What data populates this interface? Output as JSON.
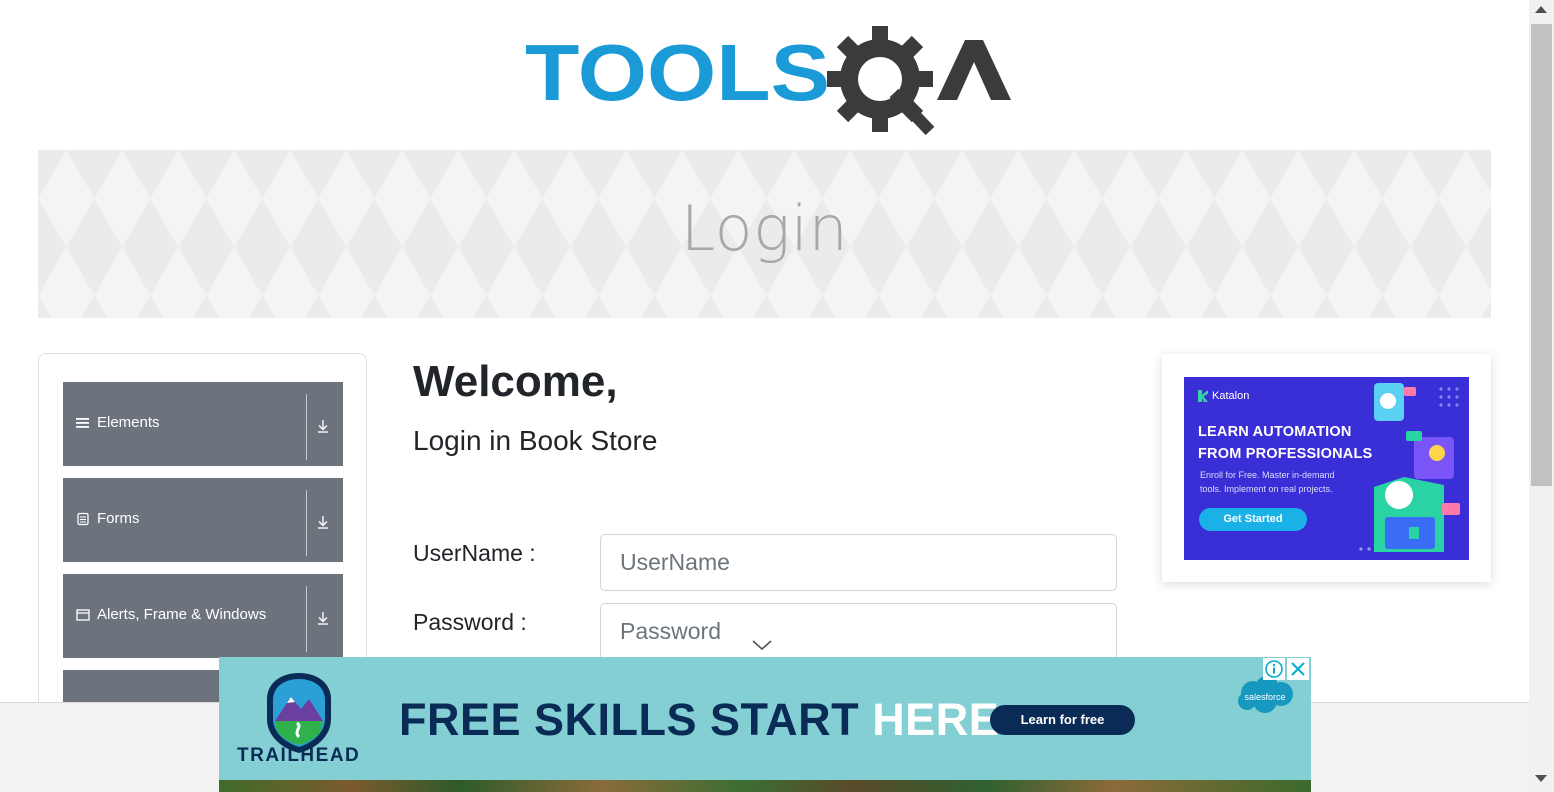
{
  "header": {
    "logo_text": "TOOLSQA",
    "colors": {
      "tools": "#1a9bd7",
      "qa": "#3b3b3b"
    }
  },
  "banner": {
    "title": "Login"
  },
  "sidebar": {
    "groups": [
      {
        "label": "Elements",
        "icon": "menu-icon"
      },
      {
        "label": "Forms",
        "icon": "document-icon"
      },
      {
        "label": "Alerts, Frame & Windows",
        "icon": "window-icon"
      },
      {
        "label": "",
        "icon": ""
      }
    ]
  },
  "main": {
    "welcome": "Welcome,",
    "subtitle": "Login in Book Store",
    "username": {
      "label": "UserName :",
      "placeholder": "UserName",
      "value": ""
    },
    "password": {
      "label": "Password :",
      "placeholder": "Password",
      "value": ""
    }
  },
  "side_ad": {
    "brand": "Katalon",
    "headline_line1": "LEARN AUTOMATION",
    "headline_line2": "FROM PROFESSIONALS",
    "subtext": "Enroll for Free. Master in-demand tools. Implement on real projects.",
    "cta": "Get Started",
    "colors": {
      "background": "#3a2fd6",
      "cta": "#19b1e6"
    }
  },
  "bottom_ad": {
    "brand": "TRAILHEAD",
    "headline": "FREE SKILLS START ",
    "headline_highlight": "HERE.",
    "cta": "Learn for free",
    "partner": "salesforce",
    "colors": {
      "background": "#84cfd3",
      "text": "#0b2b57"
    }
  }
}
